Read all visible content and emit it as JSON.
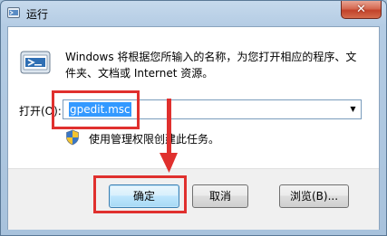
{
  "window": {
    "title": "运行",
    "close_symbol": "✕",
    "title_icon": "run-icon"
  },
  "dialog": {
    "description": "Windows 将根据您所输入的名称，为您打开相应的程序、文件夹、文档或 Internet 资源。",
    "open_label": "打开(O):",
    "open_value": "gpedit.msc",
    "dropdown_symbol": "▼",
    "admin_note": "使用管理权限创建此任务。"
  },
  "buttons": {
    "ok": "确定",
    "cancel": "取消",
    "browse": "浏览(B)..."
  },
  "annotations": {
    "highlight_color": "#e0302e"
  }
}
